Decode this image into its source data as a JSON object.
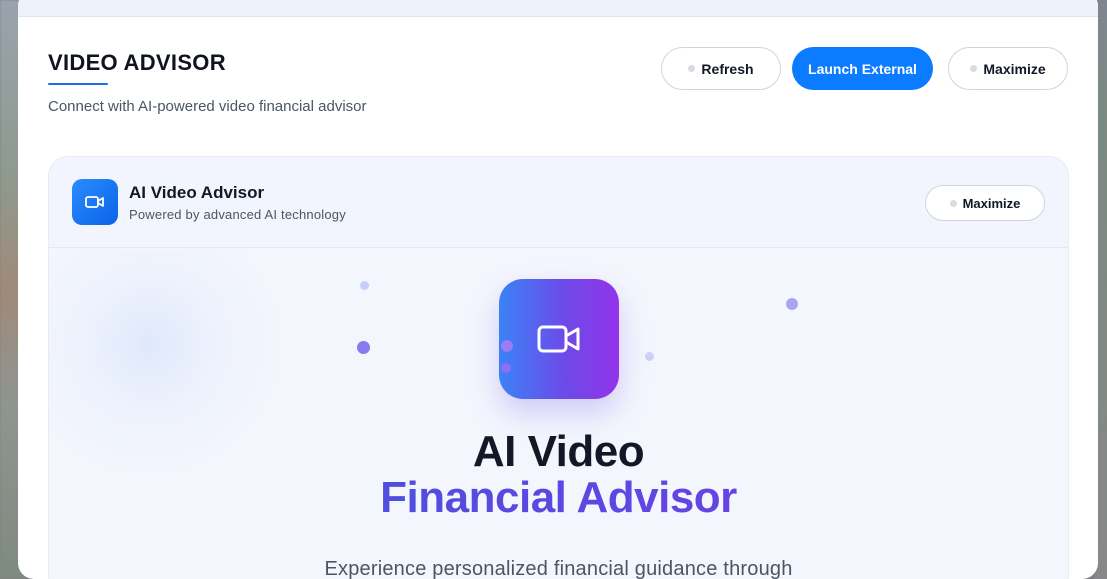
{
  "header": {
    "title": "VIDEO ADVISOR",
    "subtitle": "Connect with AI-powered video financial advisor"
  },
  "toolbar": {
    "refresh_label": "Refresh",
    "launch_label": "Launch External",
    "maximize_label": "Maximize"
  },
  "card": {
    "title": "AI Video Advisor",
    "subtitle": "Powered by advanced AI technology",
    "maximize_label": "Maximize"
  },
  "hero": {
    "title_line1": "AI Video",
    "title_line2": "Financial Advisor",
    "description": "Experience personalized financial guidance through"
  },
  "colors": {
    "primary": "#0b7cff",
    "gradient_start": "#3b82f6",
    "gradient_end": "#9333ea"
  },
  "icons": {
    "card_badge": "video-camera-icon",
    "hero": "video-camera-icon",
    "button_dot": "dot-icon"
  }
}
